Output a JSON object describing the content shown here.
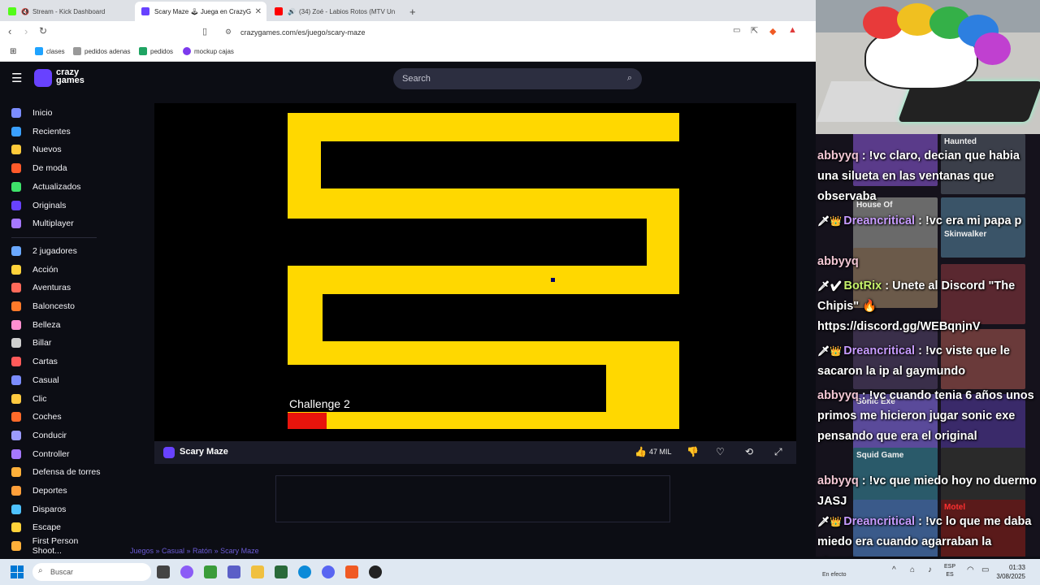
{
  "browser": {
    "tabs": [
      {
        "title": "Stream - Kick Dashboard",
        "favicon": "kick-icon"
      },
      {
        "title": "Scary Maze 🕹 Juega en CrazyG",
        "favicon": "crazygames-icon"
      },
      {
        "title": "(34) Zoé - Labios Rotos (MTV Un",
        "favicon": "youtube-icon"
      }
    ],
    "new_tab": "+",
    "close_tab": "✕",
    "url": "crazygames.com/es/juego/scary-maze",
    "bookmarks": [
      "clases",
      "pedidos adenas",
      "pedidos",
      "mockup cajas"
    ]
  },
  "site": {
    "logo_line1": "crazy",
    "logo_line2": "games",
    "search_placeholder": "Search",
    "sidebar": [
      "Inicio",
      "Recientes",
      "Nuevos",
      "De moda",
      "Actualizados",
      "Originals",
      "Multiplayer",
      "2 jugadores",
      "Acción",
      "Aventuras",
      "Baloncesto",
      "Belleza",
      "Billar",
      "Cartas",
      "Casual",
      "Clic",
      "Coches",
      "Conducir",
      "Controller",
      "Defensa de torres",
      "Deportes",
      "Disparos",
      "Escape",
      "First Person Shoot..."
    ],
    "sidebar_colors": [
      "#7b8cff",
      "#3aa0ff",
      "#ffca3a",
      "#ff5a2a",
      "#3ee36a",
      "#6842ff",
      "#a678ff",
      "#6aa8ff",
      "#ffd23a",
      "#ff6a5a",
      "#ff7a2a",
      "#ff8fd0",
      "#cfcfcf",
      "#ff5a5a",
      "#7b8cff",
      "#ffc940",
      "#ff6a2a",
      "#9b9bff",
      "#a678ff",
      "#ffb03a",
      "#ff9f3a",
      "#4ec2ff",
      "#ffd23a",
      "#ffb03a"
    ]
  },
  "game": {
    "challenge_label": "Challenge 2",
    "title": "Scary Maze",
    "likes": "47 MIL",
    "maze_color": "#ffd800",
    "breadcrumb": "Juegos » Casual » Ratón » Scary Maze"
  },
  "chat": [
    {
      "user": "abbyyq",
      "badges": "",
      "text": "!vc claro, decian que habia una silueta en las ventanas que observaba",
      "color": "u1"
    },
    {
      "user": "Dreancritical",
      "badges": "🗡👑",
      "text": "!vc era mi papa p",
      "color": "u2"
    },
    {
      "user": "abbyyq",
      "badges": "",
      "text": "",
      "color": "u1"
    },
    {
      "user": "BotRix",
      "badges": "🗡✔",
      "text": "Unete al Discord \"The Chipis\" 🔥 https://discord.gg/WEBqnjnV",
      "color": "u3"
    },
    {
      "user": "Dreancritical",
      "badges": "🗡👑",
      "text": "!vc viste que le sacaron la ip al gaymundo",
      "color": "u2"
    },
    {
      "user": "abbyyq",
      "badges": "",
      "text": "!vc cuando tenia 6 años unos primos me hicieron jugar sonic exe pensando que era el original",
      "color": "u1"
    },
    {
      "user": "abbyyq",
      "badges": "",
      "text": "!vc que miedo hoy no duermo JASJ",
      "color": "u1"
    },
    {
      "user": "Dreancritical",
      "badges": "🗡👑",
      "text": "!vc lo que me daba miedo era cuando agarraban la chancla",
      "color": "u2"
    }
  ],
  "thumbnails": [
    "Haunted",
    "House Of",
    "Skinwalker",
    "Sonic Exe",
    "Squid Game",
    "Motel"
  ],
  "taskbar": {
    "search_placeholder": "Buscar",
    "lang_top": "ESP",
    "lang_bottom": "ES",
    "time": "01:33",
    "date": "3/08/2025",
    "notice": "En efecto"
  }
}
